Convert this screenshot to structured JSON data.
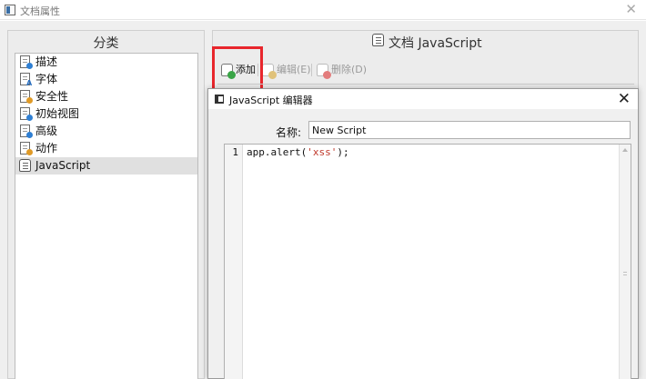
{
  "window": {
    "title": "文档属性",
    "close_glyph": "✕"
  },
  "left_panel": {
    "header": "分类",
    "items": [
      {
        "label": "描述",
        "icon": "document-info-icon"
      },
      {
        "label": "字体",
        "icon": "document-font-icon"
      },
      {
        "label": "安全性",
        "icon": "document-security-icon"
      },
      {
        "label": "初始视图",
        "icon": "document-view-icon"
      },
      {
        "label": "高级",
        "icon": "document-advanced-icon"
      },
      {
        "label": "动作",
        "icon": "document-action-icon"
      },
      {
        "label": "JavaScript",
        "icon": "script-icon",
        "selected": true
      }
    ]
  },
  "right_panel": {
    "header": "文档 JavaScript",
    "toolbar": {
      "add": "添加",
      "edit": "编辑(E)",
      "delete": "删除(D)"
    }
  },
  "dialog": {
    "title": "JavaScript 编辑器",
    "close_glyph": "✕",
    "name_label": "名称:",
    "name_value": "New Script",
    "editor": {
      "line_number": "1",
      "code_prefix": "app.alert(",
      "code_string": "'xss'",
      "code_suffix": ");"
    }
  },
  "colors": {
    "highlight": "#e8262c",
    "selected_row": "#e0e0e0",
    "string_literal": "#c0392b"
  }
}
